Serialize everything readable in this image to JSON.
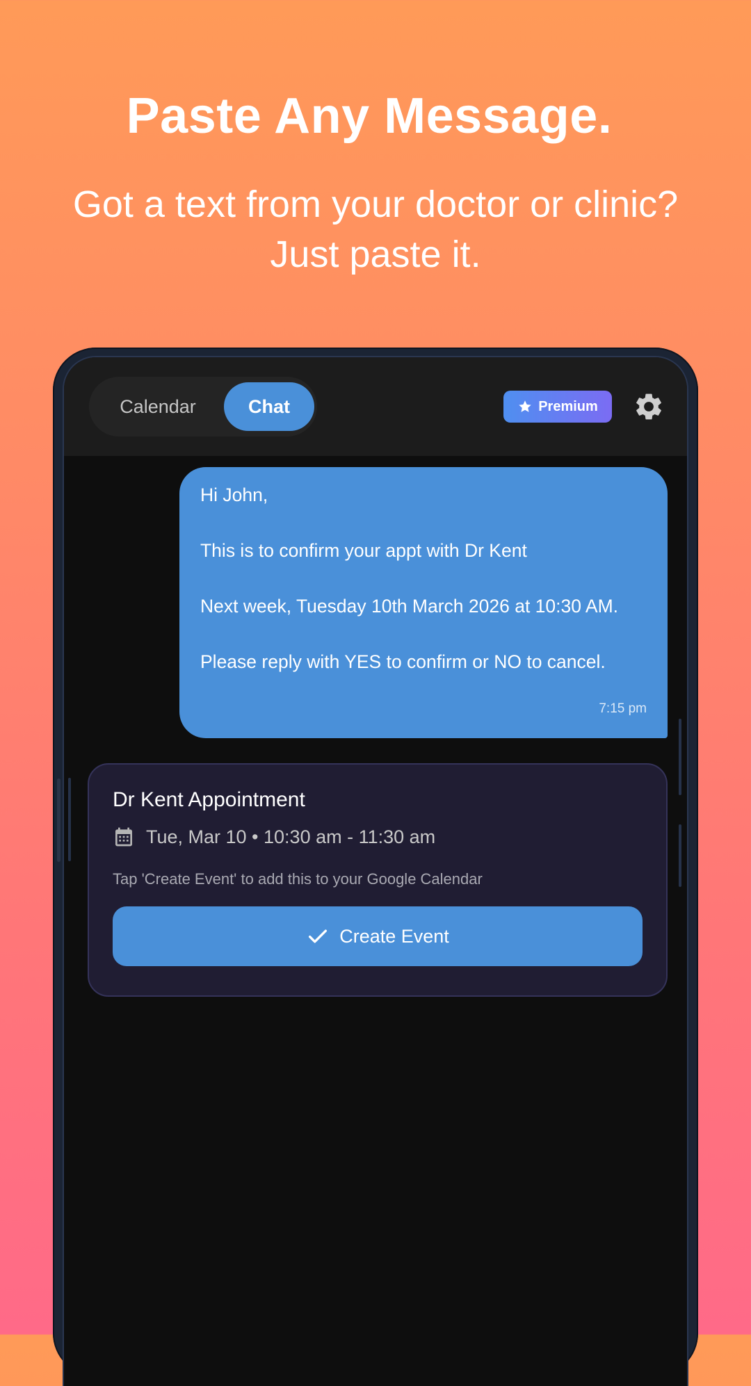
{
  "promo": {
    "headline": "Paste Any Message.",
    "subhead_line1": "Got a text from your doctor or clinic?",
    "subhead_line2": "Just paste it."
  },
  "topbar": {
    "tabs": [
      {
        "label": "Calendar",
        "active": false
      },
      {
        "label": "Chat",
        "active": true
      }
    ],
    "premium_label": "Premium",
    "premium_icon": "star-icon",
    "settings_icon": "gear-icon"
  },
  "message": {
    "lines": [
      "Hi John,",
      "This is to confirm your appt with Dr Kent",
      "Next week, Tuesday 10th March 2026 at 10:30 AM.",
      "Please reply with YES to confirm or NO to cancel."
    ],
    "time": "7:15 pm"
  },
  "event_card": {
    "title": "Dr Kent Appointment",
    "date_icon": "calendar-icon",
    "datetime": "Tue, Mar 10 • 10:30 am - 11:30 am",
    "hint": "Tap 'Create Event' to add this to your Google Calendar",
    "button_label": "Create Event",
    "button_icon": "check-icon"
  },
  "colors": {
    "accent": "#4a90d9",
    "card_bg": "#201d33",
    "screen_bg": "#0e0e0e",
    "topbar_bg": "#1c1c1c",
    "premium_gradient_start": "#4f8ff0",
    "premium_gradient_end": "#7b6cf3"
  }
}
